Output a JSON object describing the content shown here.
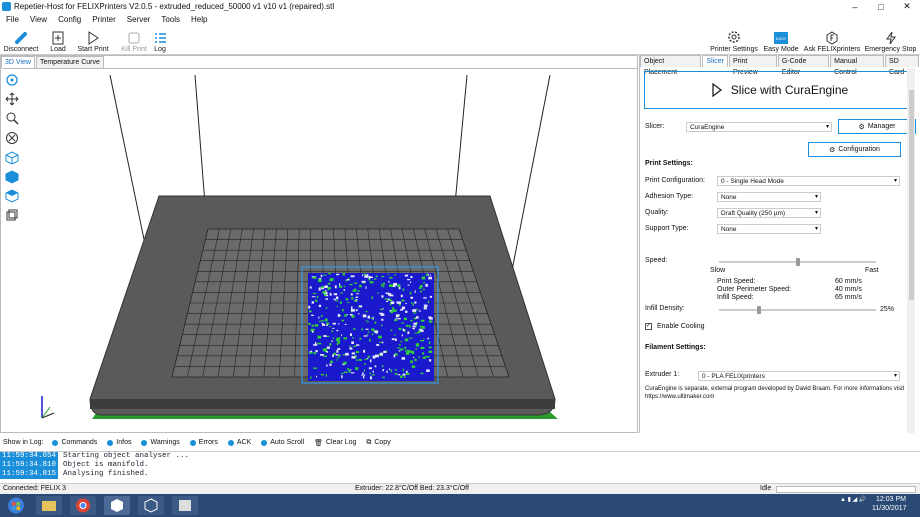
{
  "window": {
    "title": "Repetier-Host for FELIXPrinters V2.0.5 - extruded_reduced_50000 v1 v10 v1 (repaired).stl"
  },
  "menu": [
    "File",
    "View",
    "Config",
    "Printer",
    "Server",
    "Tools",
    "Help"
  ],
  "toolbar": {
    "disconnect": "Disconnect",
    "load": "Load",
    "start_print": "Start Print",
    "kill_print": "Kill Print",
    "log": "Log",
    "printer_settings": "Printer Settings",
    "easy_mode": "Easy Mode",
    "easy_badge": "EASY",
    "ask_felix": "Ask FELIXprinters",
    "emergency_stop": "Emergency Stop"
  },
  "left_tabs": [
    "3D View",
    "Temperature Curve"
  ],
  "right_tabs": [
    "Object Placement",
    "Slicer",
    "Print Preview",
    "G-Code Editor",
    "Manual Control",
    "SD Card"
  ],
  "slicer": {
    "slice_button": "Slice with CuraEngine",
    "slicer_label": "Slicer:",
    "slicer_value": "CuraEngine",
    "manager": "Manager",
    "configuration": "Configuration",
    "print_settings": "Print Settings:",
    "print_config_label": "Print Configuration:",
    "print_config_value": "0 - Single Head Mode",
    "adhesion_label": "Adhesion Type:",
    "adhesion_value": "None",
    "quality_label": "Quality:",
    "quality_value": "Draft Quality (250 µm)",
    "support_label": "Support Type:",
    "support_value": "None",
    "speed_label": "Speed:",
    "speed_slow": "Slow",
    "speed_fast": "Fast",
    "speed_level": 0.5,
    "print_speed_label": "Print Speed:",
    "print_speed_value": "60 mm/s",
    "outer_speed_label": "Outer Perimeter Speed:",
    "outer_speed_value": "40 mm/s",
    "infill_speed_label": "Infill Speed:",
    "infill_speed_value": "65 mm/s",
    "infill_label": "Infill Density:",
    "infill_value": "25%",
    "infill_level": 0.25,
    "cooling_label": "Enable Cooling",
    "filament_settings": "Filament Settings:",
    "extruder_label": "Extruder 1:",
    "extruder_value": "0 - PLA FELIXprinters",
    "note": "CuraEngine is separate, external program developed by David Braam. For more informations visit https://www.ultimaker.com"
  },
  "log_options": {
    "show_in_log": "Show in Log:",
    "commands": "Commands",
    "infos": "Infos",
    "warnings": "Warnings",
    "errors": "Errors",
    "ack": "ACK",
    "auto_scroll": "Auto Scroll",
    "clear_log": "Clear Log",
    "copy": "Copy"
  },
  "log": [
    {
      "time": "11:59:34.654",
      "msg": "Starting object analyser ..."
    },
    {
      "time": "11:59:34.810",
      "msg": "Object is manifold."
    },
    {
      "time": "11:59:34.815",
      "msg": "Analysing finished."
    }
  ],
  "status": {
    "connected": "Connected: FELIX 3",
    "temps": "Extruder: 22.8°C/Off Bed: 23.3°C/Off",
    "state": "Idle"
  },
  "clock": {
    "time": "12:03 PM",
    "date": "11/30/2017"
  },
  "colors": {
    "accent": "#1a8ed8",
    "taskbar": "#2a4a75",
    "bed": "#5a5a5a"
  }
}
